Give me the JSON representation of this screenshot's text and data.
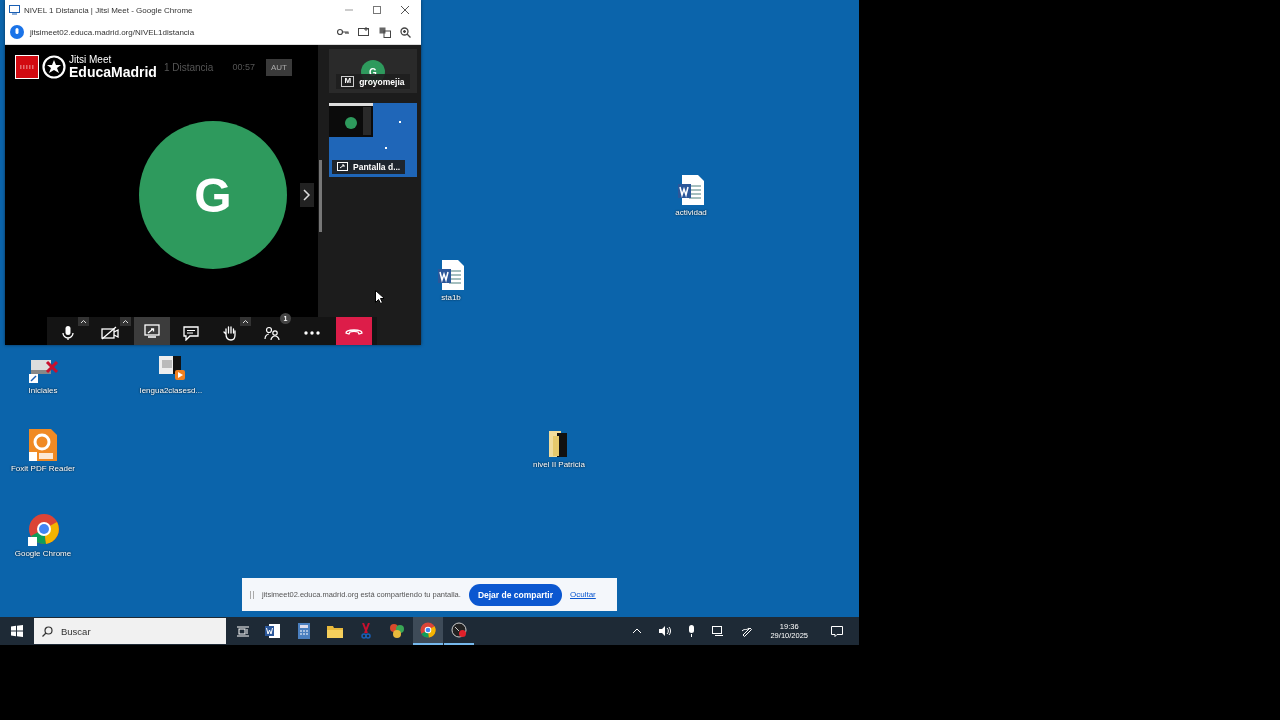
{
  "browser_window": {
    "title": "NIVEL 1 Distancia | Jitsi Meet - Google Chrome",
    "url": "jitsimeet02.educa.madrid.org/NIVEL1distancia"
  },
  "meeting": {
    "logo_top": "Jitsi Meet",
    "logo_bottom": "EducaMadrid",
    "room_name": "1 Distancia",
    "timer": "00:57",
    "badge": "AUT",
    "avatar_letter": "G"
  },
  "filmstrip": [
    {
      "kind": "participant",
      "avatar_letter": "G",
      "moderator_mark": "M",
      "name": "groyomejia"
    },
    {
      "kind": "screen",
      "name": "Pantalla d..."
    }
  ],
  "toolbar": [
    {
      "kind": "mic",
      "selected": false,
      "menu": true
    },
    {
      "kind": "camera-off",
      "selected": false,
      "menu": true
    },
    {
      "kind": "share",
      "selected": true,
      "menu": false
    },
    {
      "kind": "chat",
      "selected": false,
      "menu": false
    },
    {
      "kind": "hand",
      "selected": false,
      "menu": true
    },
    {
      "kind": "participants",
      "selected": false,
      "menu": false,
      "count": "1"
    },
    {
      "kind": "more",
      "selected": false,
      "menu": false
    },
    {
      "kind": "hangup",
      "selected": false,
      "menu": false
    }
  ],
  "desktop_icons": [
    {
      "kind": "shortcut",
      "label": "Iniciales"
    },
    {
      "kind": "video",
      "label": "lengua2clasesd..."
    },
    {
      "kind": "pdf",
      "label": "Foxit PDF Reader"
    },
    {
      "kind": "chrome",
      "label": "Google Chrome"
    },
    {
      "kind": "folder",
      "label": "nivel II Patricia"
    },
    {
      "kind": "word",
      "label": "actividad"
    },
    {
      "kind": "word",
      "label": "sta1b"
    }
  ],
  "share_bar": {
    "message": "jitsimeet02.educa.madrid.org está compartiendo tu pantalla.",
    "stop_button": "Dejar de compartir",
    "hide_link": "Ocultar"
  },
  "taskbar": {
    "search_placeholder": "Buscar",
    "apps": [
      {
        "kind": "word",
        "selected": false,
        "running": false
      },
      {
        "kind": "calculator",
        "selected": false,
        "running": false
      },
      {
        "kind": "explorer",
        "selected": false,
        "running": false
      },
      {
        "kind": "scissors",
        "selected": false,
        "running": false
      },
      {
        "kind": "tools",
        "selected": false,
        "running": false
      },
      {
        "kind": "chrome",
        "selected": true,
        "running": true
      },
      {
        "kind": "recorder",
        "selected": false,
        "running": true
      }
    ],
    "time": "19:36",
    "date": "29/10/2025"
  }
}
